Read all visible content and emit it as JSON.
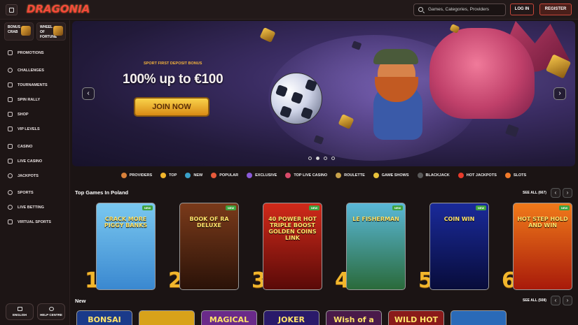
{
  "header": {
    "logo": "DRAGONIA",
    "search_placeholder": "Games, Categories, Providers",
    "login": "LOG IN",
    "register": "REGISTER"
  },
  "sidebar": {
    "tiles": [
      {
        "label": "BONUS CRAB"
      },
      {
        "label": "WHEEL OF FORTUNE"
      }
    ],
    "items": [
      {
        "label": "PROMOTIONS",
        "icon": "gift-icon"
      },
      {
        "label": "CHALLENGES",
        "icon": "medal-icon"
      },
      {
        "label": "TOURNAMENTS",
        "icon": "trophy-icon"
      },
      {
        "label": "SPIN RALLY",
        "icon": "flag-icon"
      },
      {
        "label": "SHOP",
        "icon": "cart-icon"
      },
      {
        "label": "VIP LEVELS",
        "icon": "crown-icon"
      },
      {
        "label": "CASINO",
        "icon": "cards-icon"
      },
      {
        "label": "LIVE CASINO",
        "icon": "dealer-icon"
      },
      {
        "label": "JACKPOTS",
        "icon": "coins-icon"
      },
      {
        "label": "SPORTS",
        "icon": "ball-icon"
      },
      {
        "label": "LIVE BETTING",
        "icon": "clock-icon"
      },
      {
        "label": "VIRTUAL SPORTS",
        "icon": "vr-icon"
      }
    ],
    "bottom": {
      "language": "ENGLISH",
      "help": "HELP CENTRE"
    }
  },
  "hero": {
    "kicker": "SPORT FIRST DEPOSIT BONUS",
    "title": "100% up to €100",
    "cta": "JOIN NOW",
    "prev": "‹",
    "next": "›",
    "slides_total": 4,
    "slide_active": 2
  },
  "categories": [
    {
      "label": "PROVIDERS",
      "color": "#d9813a"
    },
    {
      "label": "TOP",
      "color": "#f2b62c"
    },
    {
      "label": "NEW",
      "color": "#3aa0c8"
    },
    {
      "label": "POPULAR",
      "color": "#e85a3a"
    },
    {
      "label": "EXCLUSIVE",
      "color": "#8a5ad8"
    },
    {
      "label": "TOP LIVE CASINO",
      "color": "#d84a6a"
    },
    {
      "label": "ROULETTE",
      "color": "#c8a24a"
    },
    {
      "label": "GAME SHOWS",
      "color": "#e8c23a"
    },
    {
      "label": "BLACKJACK",
      "color": "#5a5a5a"
    },
    {
      "label": "HOT JACKPOTS",
      "color": "#e83a2a"
    },
    {
      "label": "SLOTS",
      "color": "#f07a2a"
    }
  ],
  "top_games": {
    "title": "Top Games In Poland",
    "see_all": "SEE ALL (667)",
    "badge": "NEW",
    "games": [
      {
        "rank": "1",
        "name": "CRACK MORE PIGGY BANKS",
        "bg1": "#7ac8f0",
        "bg2": "#3a88d0"
      },
      {
        "rank": "2",
        "name": "BOOK OF RA DELUXE",
        "bg1": "#7a3a1a",
        "bg2": "#2a1208"
      },
      {
        "rank": "3",
        "name": "40 POWER HOT TRIPLE BOOST GOLDEN COINS LINK",
        "bg1": "#d02a1a",
        "bg2": "#5a0a08"
      },
      {
        "rank": "4",
        "name": "LE FISHERMAN",
        "bg1": "#5ab8d8",
        "bg2": "#2a6a3a"
      },
      {
        "rank": "5",
        "name": "COIN WIN",
        "bg1": "#1a2a9a",
        "bg2": "#080c3a"
      },
      {
        "rank": "6",
        "name": "HOT STEP HOLD AND WIN",
        "bg1": "#f07a1a",
        "bg2": "#a81a0a"
      }
    ]
  },
  "new_games": {
    "title": "New",
    "see_all": "SEE ALL (508)",
    "games": [
      {
        "name": "BONSAI",
        "bg": "#1a3a8a"
      },
      {
        "name": "",
        "bg": "#d8a21a"
      },
      {
        "name": "MAGICAL",
        "bg": "#6a2a8a"
      },
      {
        "name": "JOKER",
        "bg": "#2a1a6a"
      },
      {
        "name": "Wish of a",
        "bg": "#4a1a4a"
      },
      {
        "name": "WILD HOT",
        "bg": "#8a1a1a"
      },
      {
        "name": "",
        "bg": "#2a6ab8"
      }
    ]
  }
}
